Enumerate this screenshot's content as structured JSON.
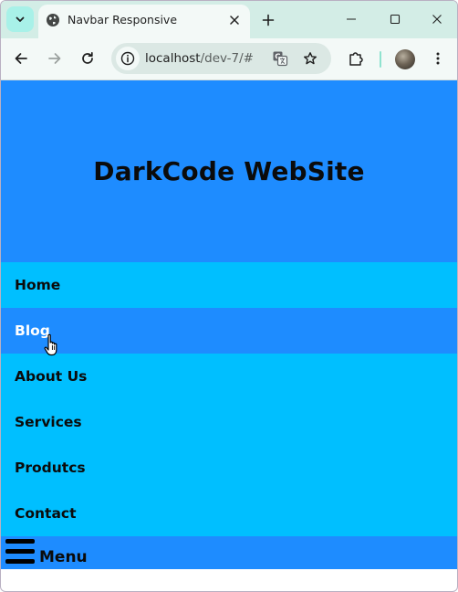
{
  "browser": {
    "tab": {
      "title": "Navbar Responsive",
      "favicon": "globe-icon"
    },
    "toolbar": {
      "url_host": "localhost",
      "url_path": "/dev-7/#"
    },
    "icons": {
      "tab_search": "chevron-down-icon",
      "tab_close": "close-icon",
      "new_tab": "plus-icon",
      "minimize": "minimize-icon",
      "maximize": "maximize-icon",
      "close": "close-icon",
      "back": "arrow-left-icon",
      "forward": "arrow-right-icon",
      "reload": "reload-icon",
      "site_info": "site-info-icon",
      "translate": "translate-icon",
      "bookmark": "star-icon",
      "extensions": "puzzle-icon",
      "profile": "avatar",
      "menu": "more-vertical-icon"
    },
    "colors": {
      "tabstrip": "#d3ede6",
      "toolbar": "#f3f9f7",
      "omnibox": "#dbe8e4"
    }
  },
  "page": {
    "title": "DarkCode WebSite",
    "nav_items": [
      {
        "label": "Home",
        "active": false
      },
      {
        "label": "Blog",
        "active": true
      },
      {
        "label": "About Us",
        "active": false
      },
      {
        "label": "Services",
        "active": false
      },
      {
        "label": "Produtcs",
        "active": false
      },
      {
        "label": "Contact",
        "active": false
      }
    ],
    "menu_toggle": {
      "label": "Menu",
      "icon": "hamburger-icon"
    },
    "colors": {
      "header_bg": "#1e8cff",
      "nav_bg": "#00bfff",
      "nav_active_bg": "#1e8cff",
      "nav_active_text": "#ffffff",
      "text": "#0b0b0b"
    }
  }
}
